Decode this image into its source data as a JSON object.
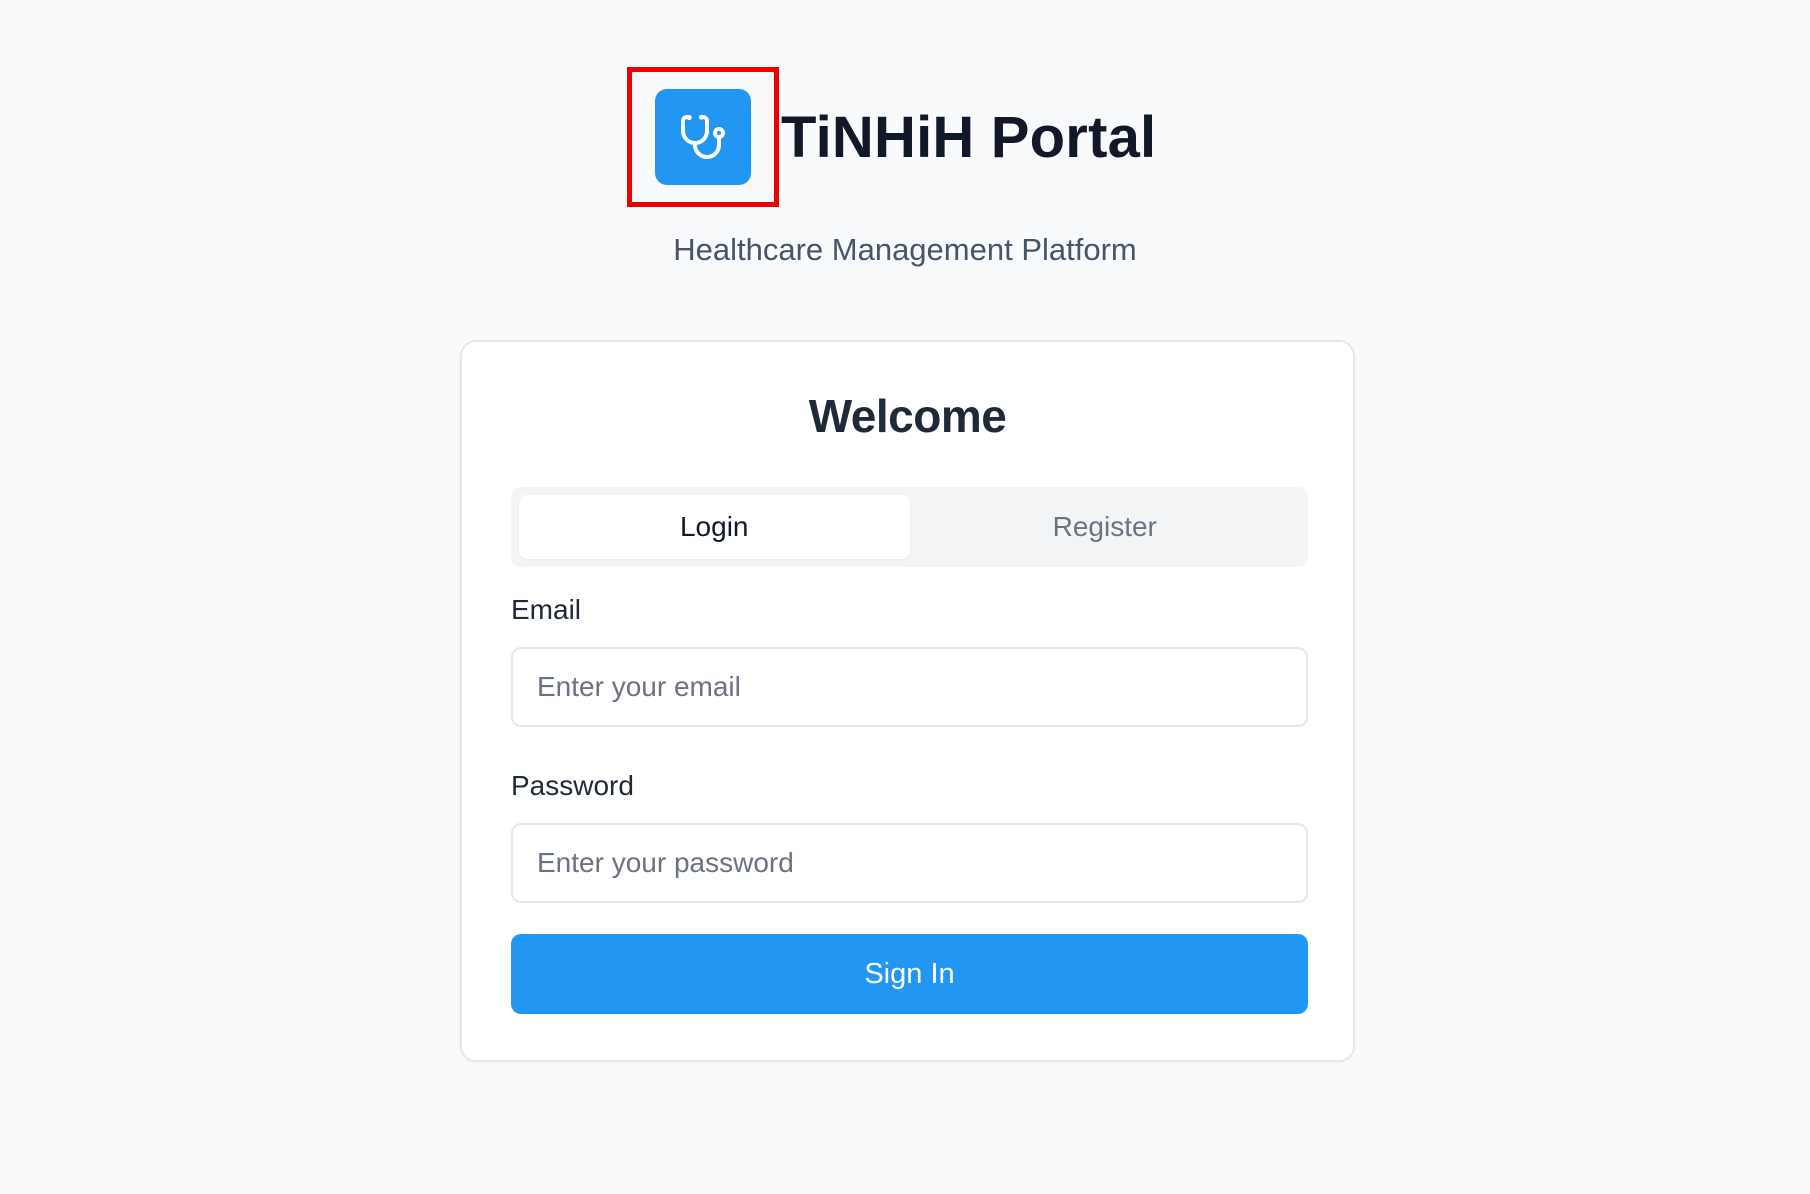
{
  "brand": {
    "title": "TiNHiH Portal",
    "subtitle": "Healthcare Management Platform",
    "logo_icon": "stethoscope-icon",
    "accent_color": "#2196f3",
    "highlight_color": "#ef0000"
  },
  "card": {
    "heading": "Welcome",
    "tabs": [
      {
        "label": "Login",
        "active": true
      },
      {
        "label": "Register",
        "active": false
      }
    ],
    "email": {
      "label": "Email",
      "placeholder": "Enter your email",
      "value": ""
    },
    "password": {
      "label": "Password",
      "placeholder": "Enter your password",
      "value": ""
    },
    "submit_label": "Sign In"
  }
}
